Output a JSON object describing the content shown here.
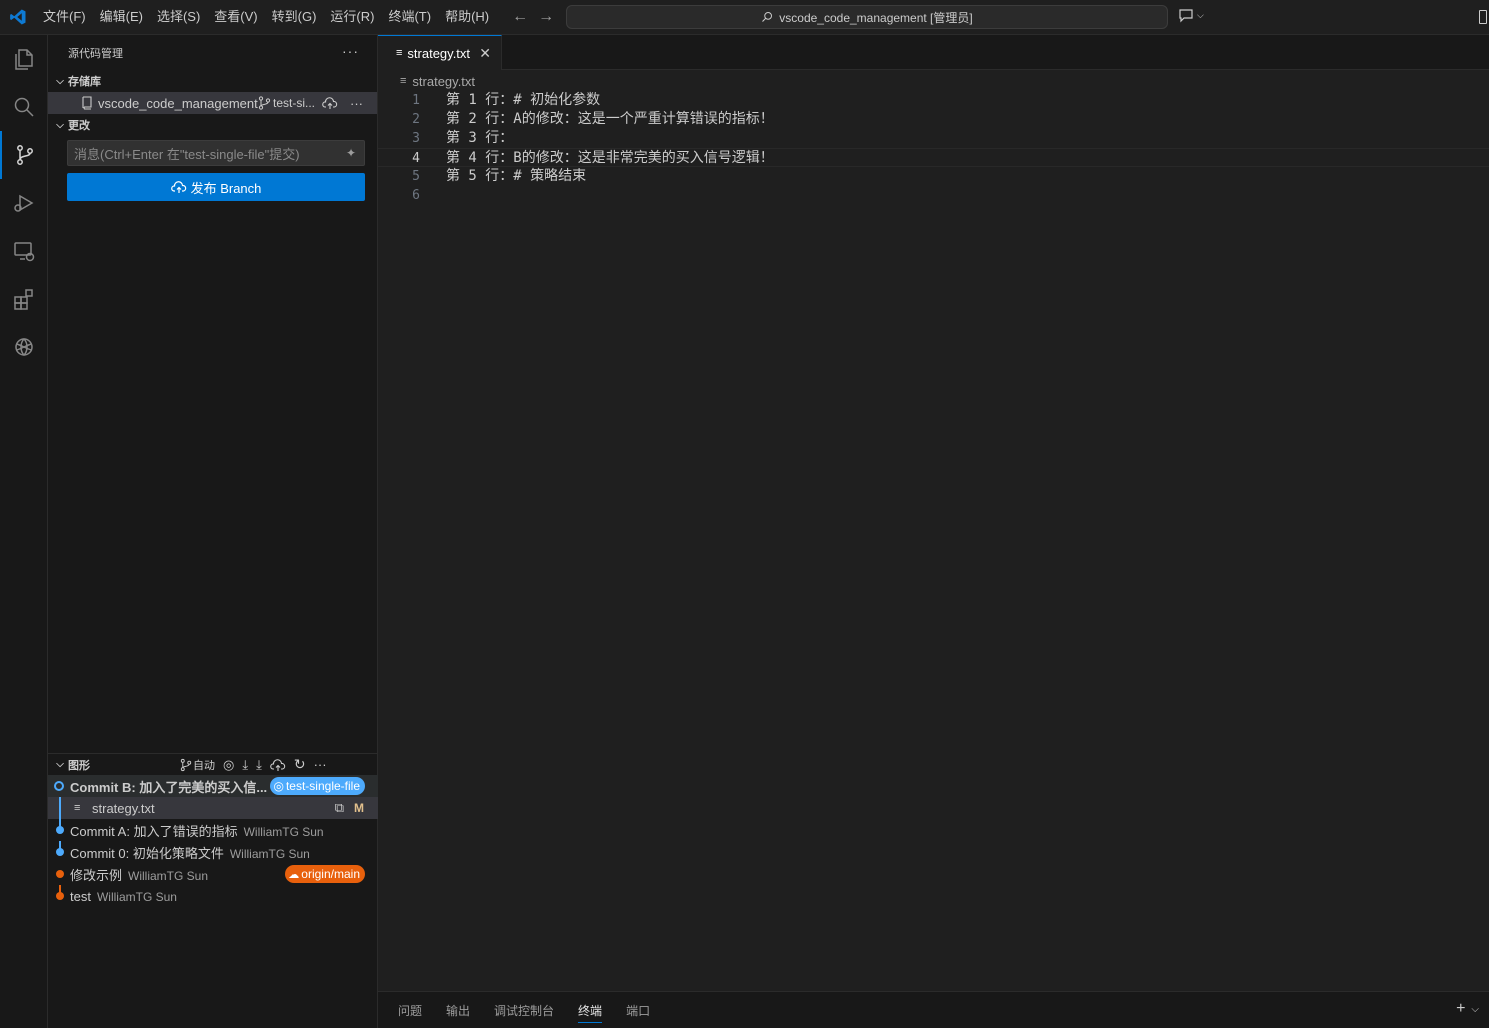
{
  "menu": [
    "文件(F)",
    "编辑(E)",
    "选择(S)",
    "查看(V)",
    "转到(G)",
    "运行(R)",
    "终端(T)",
    "帮助(H)"
  ],
  "command_center": {
    "text": "vscode_code_management [管理员]"
  },
  "sidebar": {
    "title": "源代码管理",
    "repositories_label": "存储库",
    "repo_name": "vscode_code_management",
    "branch_short": "test-si...",
    "changes_label": "更改",
    "commit_placeholder": "消息(Ctrl+Enter 在\"test-single-file\"提交)",
    "publish_label": "发布 Branch",
    "graph_label": "图形",
    "graph_auto": "自动"
  },
  "graph": {
    "commits": [
      {
        "message": "Commit B: 加入了完美的买入信...",
        "author": "",
        "badge": "test-single-file"
      },
      {
        "message": "Commit A: 加入了错误的指标",
        "author": "WilliamTG Sun",
        "badge": ""
      },
      {
        "message": "Commit 0: 初始化策略文件",
        "author": "WilliamTG Sun",
        "badge": ""
      },
      {
        "message": "修改示例",
        "author": "WilliamTG Sun",
        "badge": "origin/main"
      },
      {
        "message": "test",
        "author": "WilliamTG Sun",
        "badge": ""
      }
    ],
    "file": {
      "name": "strategy.txt",
      "status": "M"
    }
  },
  "editor": {
    "tab_label": "strategy.txt",
    "breadcrumb": "strategy.txt",
    "lines": [
      {
        "n": "1",
        "text": "第 1 行：# 初始化参数"
      },
      {
        "n": "2",
        "text": "第 2 行：A的修改：这是一个严重计算错误的指标！"
      },
      {
        "n": "3",
        "text": "第 3 行："
      },
      {
        "n": "4",
        "text": "第 4 行：B的修改：这是非常完美的买入信号逻辑！"
      },
      {
        "n": "5",
        "text": "第 5 行：# 策略结束"
      },
      {
        "n": "6",
        "text": ""
      }
    ]
  },
  "panel": {
    "tabs": [
      "问题",
      "输出",
      "调试控制台",
      "终端",
      "端口"
    ],
    "active": "终端"
  },
  "colors": {
    "accent": "#0078d4",
    "branch_badge": "#4daafc",
    "remote_badge": "#e8600c",
    "modified": "#e2c08d"
  }
}
